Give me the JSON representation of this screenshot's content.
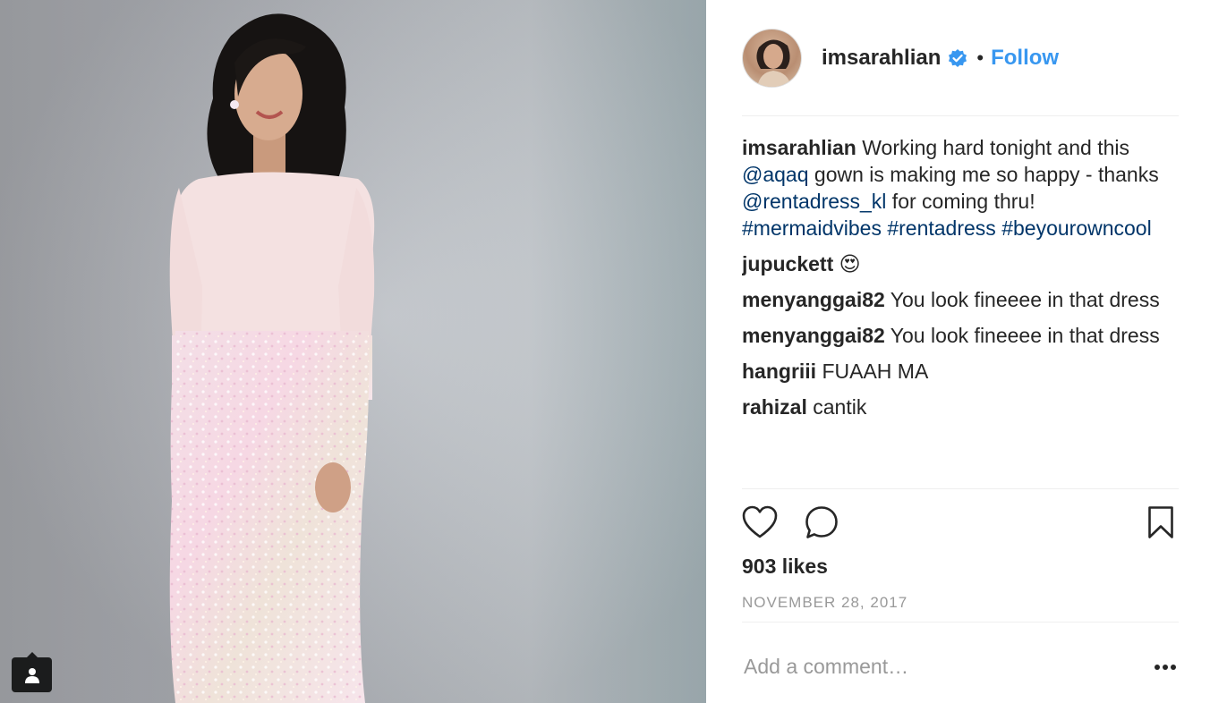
{
  "post": {
    "username": "imsarahlian",
    "follow_label": "Follow",
    "separator": "•",
    "caption": {
      "user": "imsarahlian",
      "part1": " Working hard tonight and this ",
      "mention1": "@aqaq",
      "part2": " gown is making me so happy - thanks ",
      "mention2": "@rentadress_kl",
      "part3": " for coming thru! ",
      "hashtag1": "#mermaidvibes",
      "hashtag2": "#rentadress",
      "hashtag3": "#beyourowncool"
    },
    "comments": [
      {
        "user": "jupuckett",
        "text": " 😍"
      },
      {
        "user": "menyanggai82",
        "text": " You look fineeee in that dress"
      },
      {
        "user": "menyanggai82",
        "text": " You look fineeee in that dress"
      },
      {
        "user": "hangriii",
        "text": " FUAAH MA"
      },
      {
        "user": "rahizal",
        "text": " cantik"
      }
    ],
    "likes": "903 likes",
    "date": "NOVEMBER 28, 2017",
    "add_comment_placeholder": "Add a comment…"
  },
  "icons": {
    "like": "heart-icon",
    "comment": "comment-bubble-icon",
    "save": "bookmark-icon",
    "more": "more-options-icon",
    "verified": "verified-badge-icon",
    "tag": "user-tag-icon"
  },
  "colors": {
    "accent": "#3897f0",
    "link": "#003569",
    "text": "#262626",
    "muted": "#999999"
  }
}
